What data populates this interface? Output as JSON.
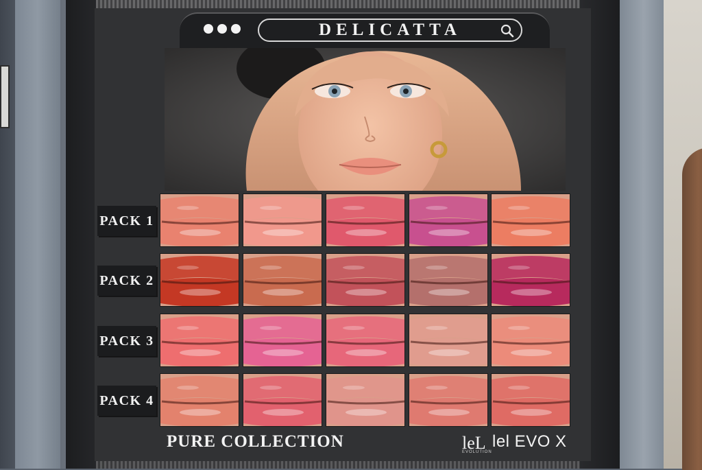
{
  "brand": {
    "name": "DELICATTA"
  },
  "header": {
    "dots": 3
  },
  "packs": [
    {
      "label": "PACK 1",
      "swatches": [
        "#e9826f",
        "#f1988c",
        "#e0596c",
        "#c8508f",
        "#ec7d62"
      ]
    },
    {
      "label": "PACK 2",
      "swatches": [
        "#c43824",
        "#c96b4f",
        "#c2525a",
        "#b4706c",
        "#b72a5d"
      ]
    },
    {
      "label": "PACK 3",
      "swatches": [
        "#ee6e6f",
        "#e56393",
        "#e7677a",
        "#e09c8e",
        "#ec8b7a"
      ]
    },
    {
      "label": "PACK 4",
      "swatches": [
        "#e3826d",
        "#e2616e",
        "#e0948b",
        "#df7a70",
        "#df6b64"
      ]
    }
  ],
  "footer": {
    "collection": "PURE COLLECTION",
    "logo_text": "lel EVO X",
    "logo_mark": "leL",
    "logo_sub": "EVOLUTION"
  },
  "colors": {
    "panel": "#313234",
    "label_bg": "#1b1c1e",
    "text": "#f2f2f2"
  }
}
